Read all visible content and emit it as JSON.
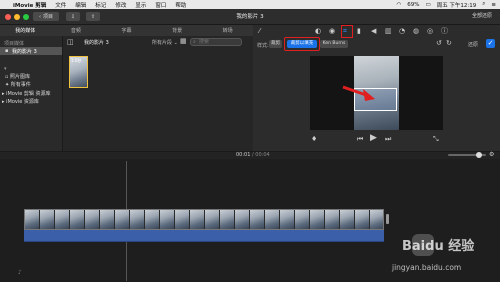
{
  "menubar": {
    "apple": "",
    "items": [
      "iMovie 剪辑",
      "文件",
      "编辑",
      "标记",
      "修改",
      "显示",
      "窗口",
      "帮助"
    ],
    "battery": "69%",
    "clock": "周五 下午12:19"
  },
  "window": {
    "back_label": "项目",
    "title": "我的影片 3",
    "fullscreen_label": "全部还原"
  },
  "tabs": {
    "items": [
      "我的媒体",
      "音频",
      "字幕",
      "背景",
      "转场"
    ]
  },
  "library": {
    "header": "项目媒体",
    "project_item": "我的影片 3",
    "section_photos": "照片图库",
    "section_all_events": "所有事件",
    "lib1": "iMovie 剪辑 资源库",
    "lib2": "iMovie 资源库"
  },
  "browser": {
    "title": "我的影片 3",
    "filter": "所有片段",
    "search_placeholder": "搜索",
    "clip_duration": "1.0秒"
  },
  "viewer": {
    "style_label": "样式:",
    "crop_options": [
      "裁剪",
      "裁剪以填充",
      "Ken Burns"
    ],
    "reset_label": "还原",
    "timecode_current": "00:01",
    "timecode_total": "00:04"
  },
  "watermark": {
    "brand": "Baidu 经验",
    "url": "jingyan.baidu.com"
  },
  "colors": {
    "accent": "#1a73e8",
    "highlight": "#e02020",
    "audio_track": "#3b5fa8"
  }
}
